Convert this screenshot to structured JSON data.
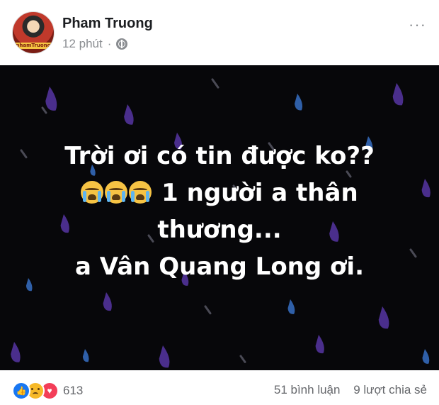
{
  "author": {
    "name": "Pham Truong",
    "avatar_label": "phamTruong"
  },
  "meta": {
    "time": "12 phút",
    "separator": "·",
    "privacy_icon": "globe-icon"
  },
  "menu": {
    "label": "···"
  },
  "post": {
    "background": "#07070a",
    "lines": [
      "Trời ơi có tin được ko??",
      "1 người a thân",
      "thương...",
      "a Vân Quang Long ơi."
    ],
    "emoji_count": 3,
    "emoji_name": "loudly-crying-face"
  },
  "footer": {
    "reactions": [
      "like",
      "sad",
      "love"
    ],
    "reaction_count": "613",
    "comments": "51 bình luận",
    "shares": "9 lượt chia sẻ"
  },
  "colors": {
    "rain_purple": "#4a2e8c",
    "rain_blue": "#2f5fa8",
    "rain_gray": "#4a4a55"
  }
}
